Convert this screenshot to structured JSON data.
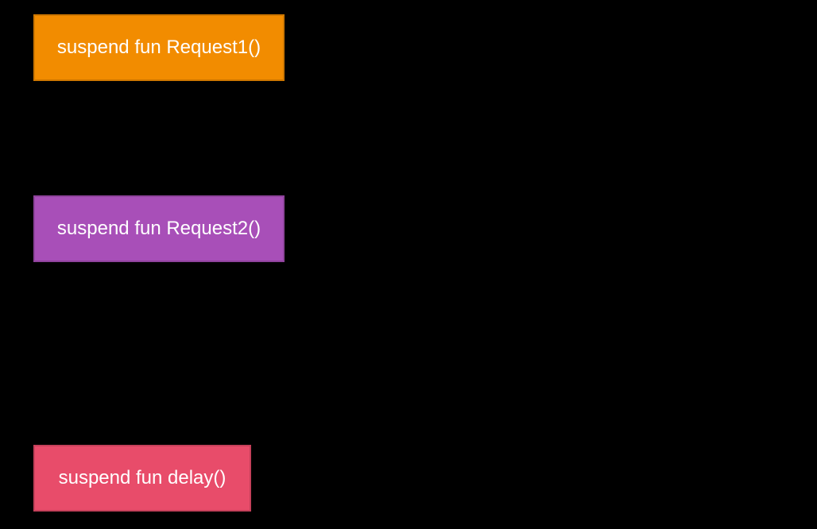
{
  "functions": {
    "request1": {
      "label": "suspend fun Request1()",
      "color": "#f28c00"
    },
    "request2": {
      "label": "suspend fun Request2()",
      "color": "#a84fb8"
    },
    "delay": {
      "label": "suspend fun delay()",
      "color": "#e84c6a"
    }
  }
}
